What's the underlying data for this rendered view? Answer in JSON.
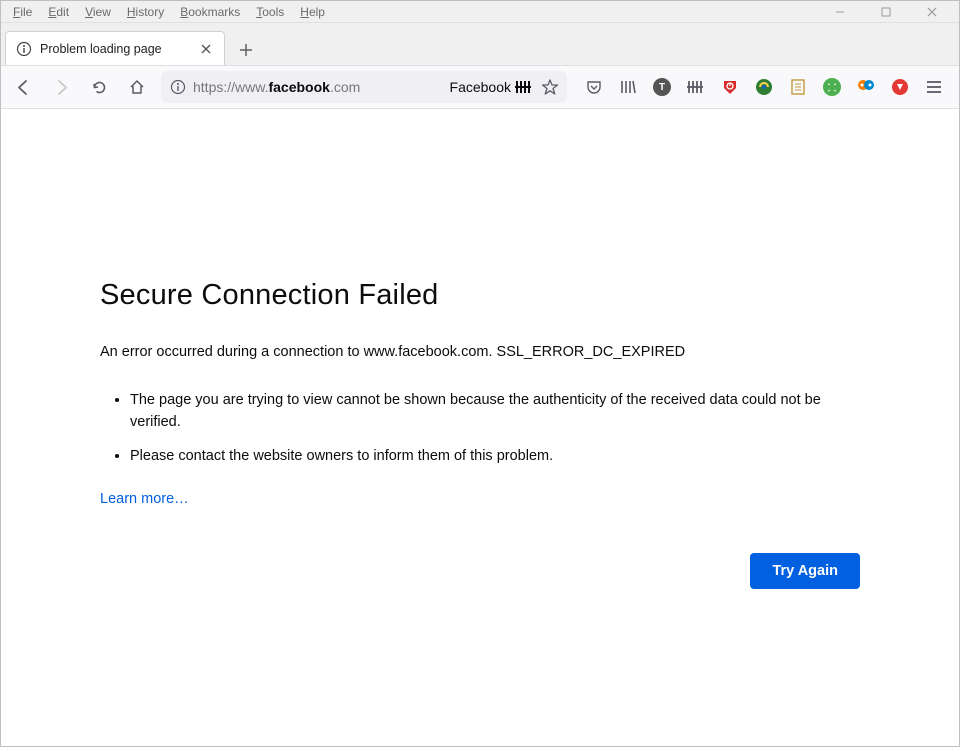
{
  "menu": {
    "file": "File",
    "edit": "Edit",
    "view": "View",
    "history": "History",
    "bookmarks": "Bookmarks",
    "tools": "Tools",
    "help": "Help"
  },
  "tab": {
    "title": "Problem loading page"
  },
  "url": {
    "prefix": "https://www.",
    "highlight": "facebook",
    "suffix": ".com",
    "badge": "Facebook"
  },
  "error": {
    "title": "Secure Connection Failed",
    "short": "An error occurred during a connection to www.facebook.com. SSL_ERROR_DC_EXPIRED",
    "bullet1": "The page you are trying to view cannot be shown because the authenticity of the received data could not be verified.",
    "bullet2": "Please contact the website owners to inform them of this problem.",
    "learn": "Learn more…",
    "try": "Try Again"
  }
}
